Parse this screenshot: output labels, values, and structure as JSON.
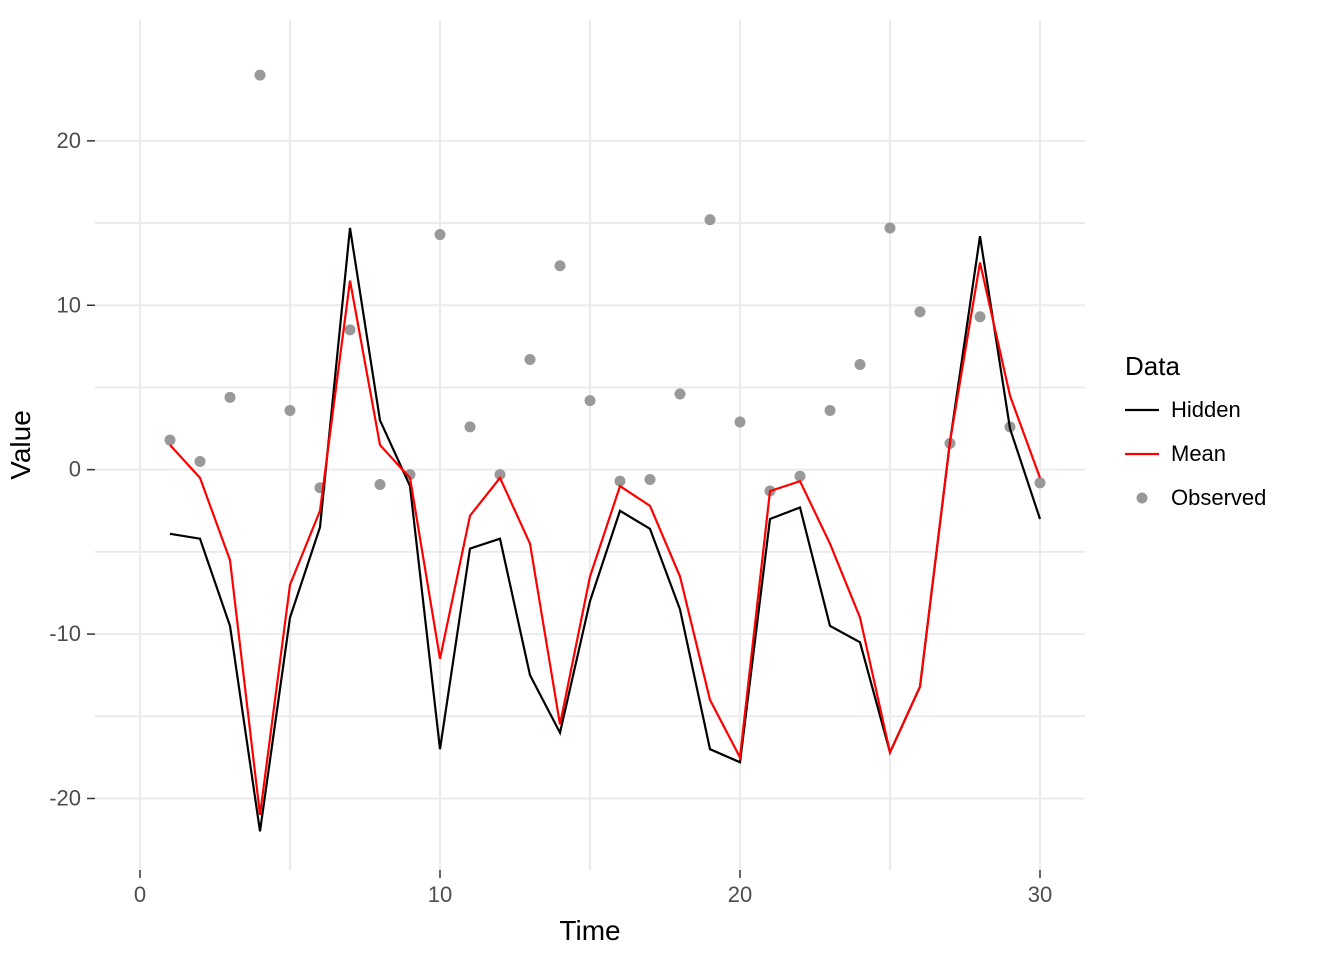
{
  "chart_data": {
    "type": "line",
    "xlabel": "Time",
    "ylabel": "Value",
    "xlim": [
      0,
      30
    ],
    "ylim": [
      -22,
      25
    ],
    "x_ticks": [
      0,
      10,
      20,
      30
    ],
    "y_ticks": [
      -20,
      -10,
      0,
      10,
      20
    ],
    "grid": true,
    "legend_title": "Data",
    "legend_position": "right",
    "x": [
      1,
      2,
      3,
      4,
      5,
      6,
      7,
      8,
      9,
      10,
      11,
      12,
      13,
      14,
      15,
      16,
      17,
      18,
      19,
      20,
      21,
      22,
      23,
      24,
      25,
      26,
      27,
      28,
      29,
      30
    ],
    "series": [
      {
        "name": "Hidden",
        "style": "line",
        "color": "#000000",
        "values": [
          -3.9,
          -4.2,
          -9.5,
          -22.0,
          -9.0,
          -3.5,
          14.7,
          3.0,
          -1.0,
          -17.0,
          -4.8,
          -4.2,
          -12.5,
          -16.0,
          -8.0,
          -2.5,
          -3.6,
          -8.5,
          -17.0,
          -17.8,
          -3.0,
          -2.3,
          -9.5,
          -10.5,
          -17.2,
          -13.2,
          1.7,
          14.2,
          2.5,
          -3.0
        ]
      },
      {
        "name": "Mean",
        "style": "line",
        "color": "#ff0000",
        "values": [
          1.5,
          -0.5,
          -5.5,
          -21.0,
          -7.0,
          -2.5,
          11.5,
          1.5,
          -0.5,
          -11.5,
          -2.8,
          -0.5,
          -4.5,
          -15.5,
          -6.5,
          -1.0,
          -2.2,
          -6.5,
          -14.0,
          -17.5,
          -1.3,
          -0.7,
          -4.5,
          -9.0,
          -17.2,
          -13.2,
          1.7,
          12.6,
          4.5,
          -0.5
        ]
      },
      {
        "name": "Observed",
        "style": "points",
        "color": "#999999",
        "values": [
          1.8,
          0.5,
          4.4,
          24.0,
          3.6,
          -1.1,
          8.5,
          -0.9,
          -0.3,
          14.3,
          2.6,
          -0.3,
          6.7,
          12.4,
          4.2,
          -0.7,
          -0.6,
          4.6,
          15.2,
          2.9,
          -1.3,
          -0.4,
          3.6,
          6.4,
          14.7,
          9.6,
          1.6,
          9.3,
          2.6,
          -0.8
        ]
      }
    ]
  },
  "axes": {
    "x_title": "Time",
    "y_title": "Value",
    "x_tick_labels": [
      "0",
      "10",
      "20",
      "30"
    ],
    "y_tick_labels": [
      "-20",
      "-10",
      "0",
      "10",
      "20"
    ]
  },
  "legend": {
    "title": "Data",
    "items": [
      "Hidden",
      "Mean",
      "Observed"
    ]
  }
}
